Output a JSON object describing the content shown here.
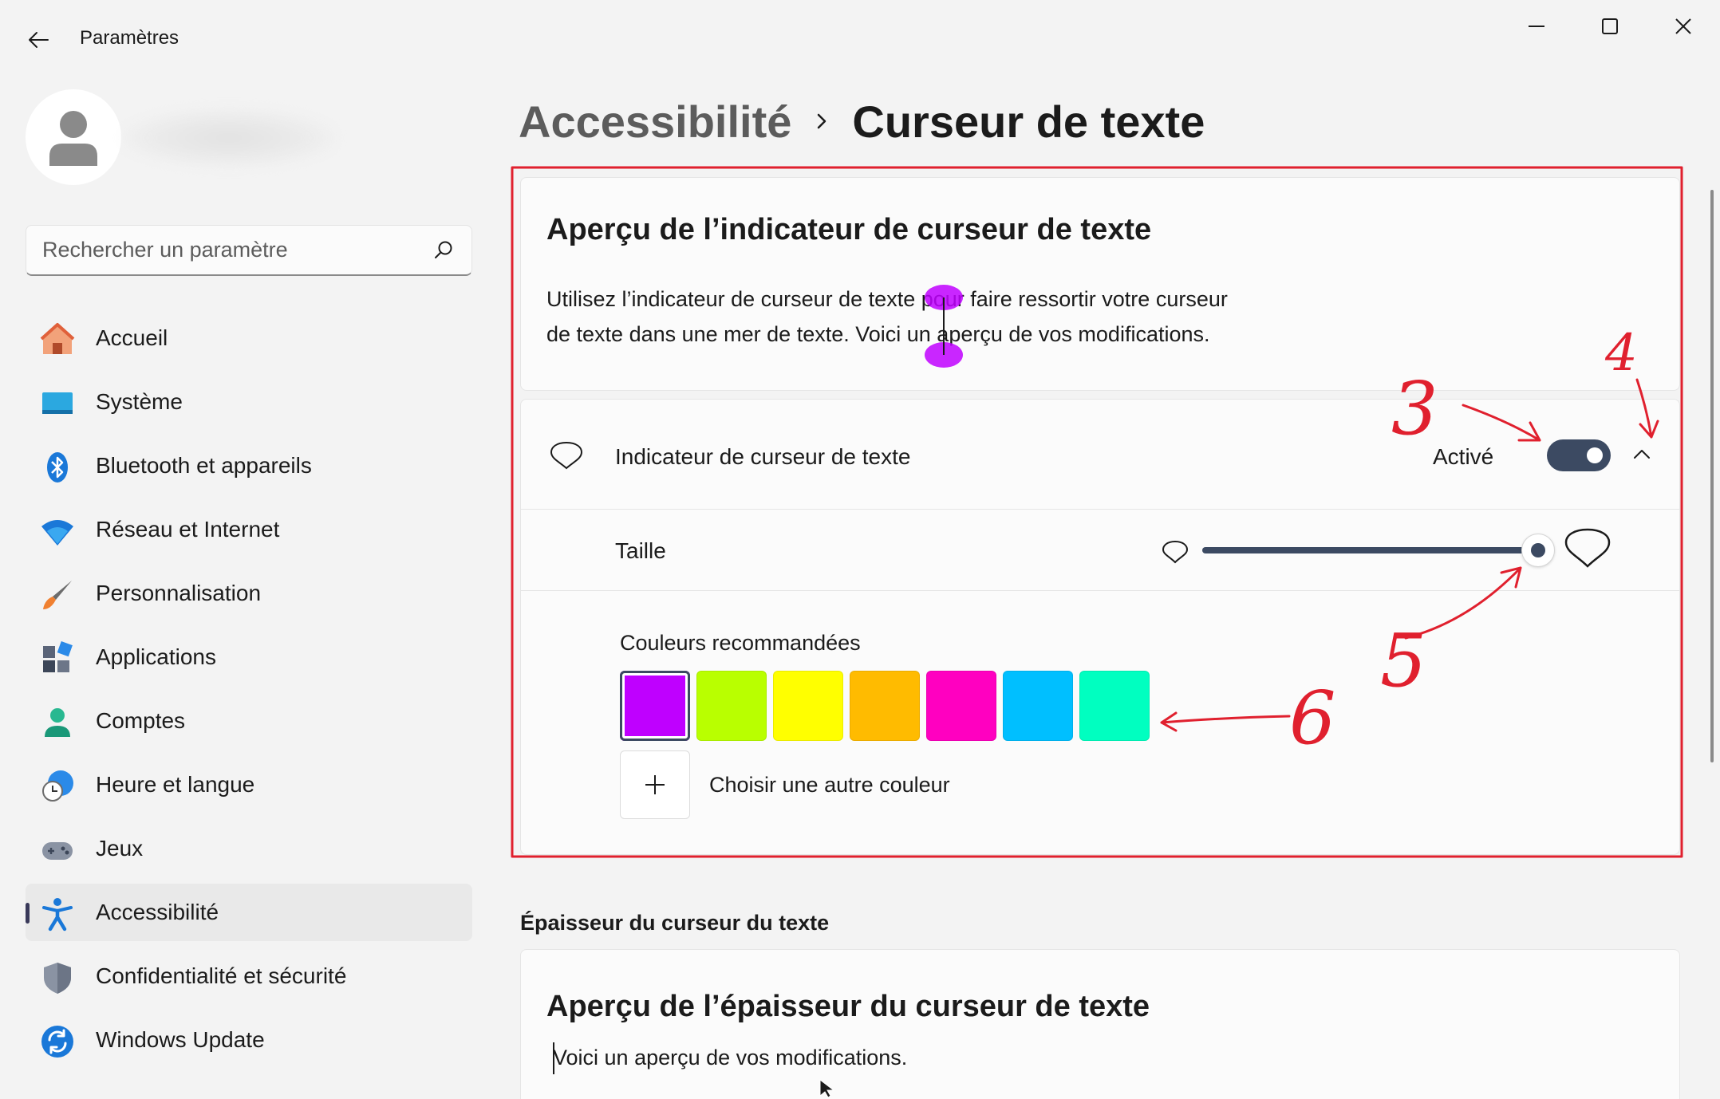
{
  "window": {
    "title": "Paramètres"
  },
  "search": {
    "placeholder": "Rechercher un paramètre"
  },
  "sidebar": {
    "items": [
      {
        "label": "Accueil",
        "icon": "home-icon"
      },
      {
        "label": "Système",
        "icon": "system-icon"
      },
      {
        "label": "Bluetooth et appareils",
        "icon": "bluetooth-icon"
      },
      {
        "label": "Réseau et Internet",
        "icon": "wifi-icon"
      },
      {
        "label": "Personnalisation",
        "icon": "brush-icon"
      },
      {
        "label": "Applications",
        "icon": "apps-icon"
      },
      {
        "label": "Comptes",
        "icon": "account-icon"
      },
      {
        "label": "Heure et langue",
        "icon": "globe-clock-icon"
      },
      {
        "label": "Jeux",
        "icon": "gamepad-icon"
      },
      {
        "label": "Accessibilité",
        "icon": "accessibility-icon",
        "active": true
      },
      {
        "label": "Confidentialité et sécurité",
        "icon": "shield-icon"
      },
      {
        "label": "Windows Update",
        "icon": "update-icon"
      }
    ]
  },
  "breadcrumb": {
    "parent": "Accessibilité",
    "current": "Curseur de texte"
  },
  "preview": {
    "title": "Aperçu de l’indicateur de curseur de texte",
    "line1": "Utilisez l’indicateur de curseur de texte pour faire ressortir votre curseur",
    "line2": "de texte dans une mer de texte. Voici un aperçu de vos modifications."
  },
  "indicator": {
    "label": "Indicateur de curseur de texte",
    "status": "Activé",
    "enabled": true,
    "size_label": "Taille",
    "size_level": 1.0,
    "colors_label": "Couleurs recommandées",
    "colors": [
      "#bf00ff",
      "#b9ff00",
      "#ffff00",
      "#ffbb00",
      "#ff00c0",
      "#00bfff",
      "#00ffc0"
    ],
    "selected_color": "#bf00ff",
    "add_color_label": "Choisir une autre couleur"
  },
  "thickness": {
    "heading": "Épaisseur du curseur du texte",
    "title": "Aperçu de l’épaisseur du curseur de texte",
    "text": "Voici un aperçu de vos modifications."
  },
  "annotations": {
    "color": "#e0202e",
    "labels": [
      "3",
      "4",
      "5",
      "6"
    ]
  }
}
